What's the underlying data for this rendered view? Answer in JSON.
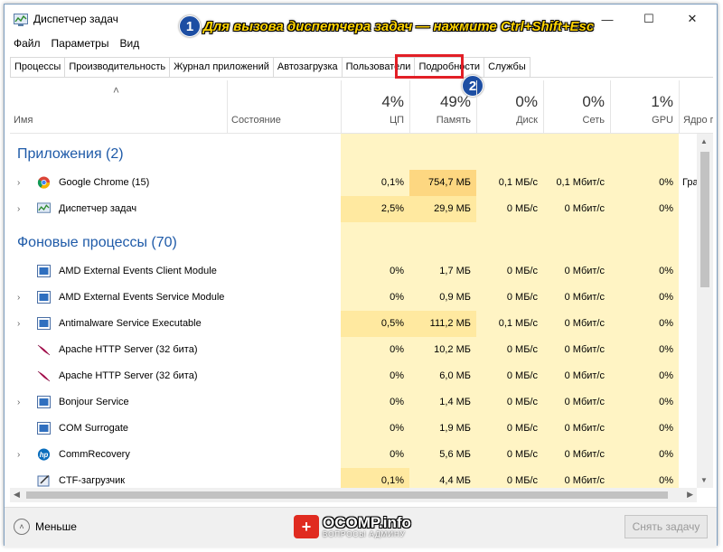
{
  "window": {
    "title": "Диспетчер задач",
    "controls": {
      "minimize": "—",
      "maximize": "☐",
      "close": "✕"
    }
  },
  "menu": [
    "Файл",
    "Параметры",
    "Вид"
  ],
  "tabs": [
    "Процессы",
    "Производительность",
    "Журнал приложений",
    "Автозагрузка",
    "Пользователи",
    "Подробности",
    "Службы"
  ],
  "active_tab": "Процессы",
  "annotation": {
    "badge1": "1",
    "callout": "Для вызова диспетчера задач — нажмите Ctrl+Shift+Esc",
    "badge2": "2"
  },
  "columns": {
    "name": "Имя",
    "status": "Состояние",
    "cpu": {
      "pct": "4%",
      "label": "ЦП"
    },
    "mem": {
      "pct": "49%",
      "label": "Память"
    },
    "disk": {
      "pct": "0%",
      "label": "Диск"
    },
    "net": {
      "pct": "0%",
      "label": "Сеть"
    },
    "gpu": {
      "pct": "1%",
      "label": "GPU"
    },
    "gpu_engine": "Ядро гра"
  },
  "groups": {
    "apps": "Приложения (2)",
    "background": "Фоновые процессы (70)"
  },
  "apps": [
    {
      "name": "Google Chrome (15)",
      "cpu": "0,1%",
      "mem": "754,7 МБ",
      "disk": "0,1 МБ/с",
      "net": "0,1 Мбит/с",
      "gpu": "0%",
      "engine": "Граф",
      "icon": "chrome-icon"
    },
    {
      "name": "Диспетчер задач",
      "cpu": "2,5%",
      "mem": "29,9 МБ",
      "disk": "0 МБ/с",
      "net": "0 Мбит/с",
      "gpu": "0%",
      "engine": "",
      "icon": "taskmgr-icon"
    }
  ],
  "background": [
    {
      "name": "AMD External Events Client Module",
      "cpu": "0%",
      "mem": "1,7 МБ",
      "disk": "0 МБ/с",
      "net": "0 Мбит/с",
      "gpu": "0%",
      "expand": false,
      "icon": "service-icon"
    },
    {
      "name": "AMD External Events Service Module",
      "cpu": "0%",
      "mem": "0,9 МБ",
      "disk": "0 МБ/с",
      "net": "0 Мбит/с",
      "gpu": "0%",
      "expand": true,
      "icon": "service-icon"
    },
    {
      "name": "Antimalware Service Executable",
      "cpu": "0,5%",
      "mem": "111,2 МБ",
      "disk": "0,1 МБ/с",
      "net": "0 Мбит/с",
      "gpu": "0%",
      "expand": true,
      "icon": "service-icon"
    },
    {
      "name": "Apache HTTP Server (32 бита)",
      "cpu": "0%",
      "mem": "10,2 МБ",
      "disk": "0 МБ/с",
      "net": "0 Мбит/с",
      "gpu": "0%",
      "expand": false,
      "icon": "apache-feather-icon"
    },
    {
      "name": "Apache HTTP Server (32 бита)",
      "cpu": "0%",
      "mem": "6,0 МБ",
      "disk": "0 МБ/с",
      "net": "0 Мбит/с",
      "gpu": "0%",
      "expand": false,
      "icon": "apache-feather-icon"
    },
    {
      "name": "Bonjour Service",
      "cpu": "0%",
      "mem": "1,4 МБ",
      "disk": "0 МБ/с",
      "net": "0 Мбит/с",
      "gpu": "0%",
      "expand": true,
      "icon": "service-icon"
    },
    {
      "name": "COM Surrogate",
      "cpu": "0%",
      "mem": "1,9 МБ",
      "disk": "0 МБ/с",
      "net": "0 Мбит/с",
      "gpu": "0%",
      "expand": false,
      "icon": "service-icon"
    },
    {
      "name": "CommRecovery",
      "cpu": "0%",
      "mem": "5,6 МБ",
      "disk": "0 МБ/с",
      "net": "0 Мбит/с",
      "gpu": "0%",
      "expand": true,
      "icon": "hp-icon"
    },
    {
      "name": "CTF-загрузчик",
      "cpu": "0,1%",
      "mem": "4,4 МБ",
      "disk": "0 МБ/с",
      "net": "0 Мбит/с",
      "gpu": "0%",
      "expand": false,
      "icon": "ctf-icon"
    }
  ],
  "footer": {
    "less": "Меньше",
    "end_task": "Снять задачу",
    "logo_text": "OCOMP.info",
    "logo_sub": "ВОПРОСЫ АДМИНУ"
  },
  "colors": {
    "cell_light": "#fff4c4",
    "cell_mid": "#ffe9a0",
    "cell_strong": "#fdd781",
    "group_blue": "#1e5aa8",
    "highlight_red": "#e21f26",
    "badge_blue": "#1d4ea3",
    "callout_yellow": "#ffd400"
  }
}
